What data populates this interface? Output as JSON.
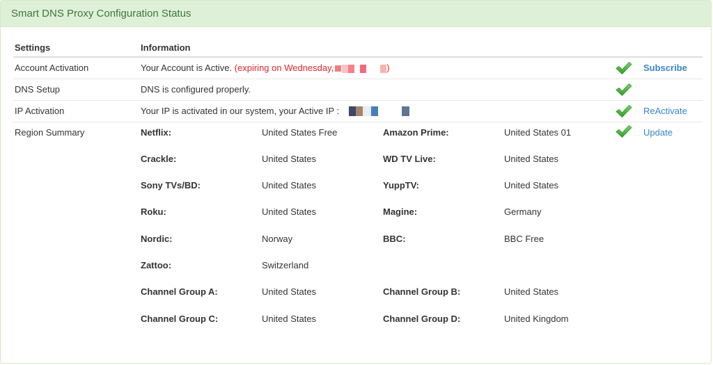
{
  "header": {
    "title": "Smart DNS Proxy Configuration Status"
  },
  "table": {
    "headers": {
      "settings": "Settings",
      "information": "Information"
    },
    "rows": {
      "account": {
        "label": "Account Activation",
        "info": "Your Account is Active.",
        "expiring_prefix": "(expiring on Wednesday,",
        "expiring_suffix": ")",
        "action": "Subscribe"
      },
      "dns": {
        "label": "DNS Setup",
        "info": "DNS is configured properly."
      },
      "ip": {
        "label": "IP Activation",
        "info": "Your IP is activated in our system, your Active IP :",
        "action": "ReActivate"
      },
      "region": {
        "label": "Region Summary",
        "action": "Update",
        "items": [
          {
            "service": "Netflix:",
            "region": "United States Free"
          },
          {
            "service": "Amazon Prime:",
            "region": "United States 01"
          },
          {
            "service": "Crackle:",
            "region": "United States"
          },
          {
            "service": "WD TV Live:",
            "region": "United States"
          },
          {
            "service": "Sony TVs/BD:",
            "region": "United States"
          },
          {
            "service": "YuppTV:",
            "region": "United States"
          },
          {
            "service": "Roku:",
            "region": "United States"
          },
          {
            "service": "Magine:",
            "region": "Germany"
          },
          {
            "service": "Nordic:",
            "region": "Norway"
          },
          {
            "service": "BBC:",
            "region": "BBC Free"
          },
          {
            "service": "Zattoo:",
            "region": "Switzerland"
          },
          {
            "service": "",
            "region": ""
          },
          {
            "service": "Channel Group A:",
            "region": "United States"
          },
          {
            "service": "Channel Group B:",
            "region": "United States"
          },
          {
            "service": "Channel Group C:",
            "region": "United States"
          },
          {
            "service": "Channel Group D:",
            "region": "United Kingdom"
          }
        ]
      }
    }
  },
  "icons": {
    "status_ok": "check-mark-icon"
  },
  "colors": {
    "heading_bg": "#dff0d8",
    "heading_text": "#3c763d",
    "expiring": "#e0262d",
    "link": "#3a85c6",
    "check": "#4caf50"
  }
}
